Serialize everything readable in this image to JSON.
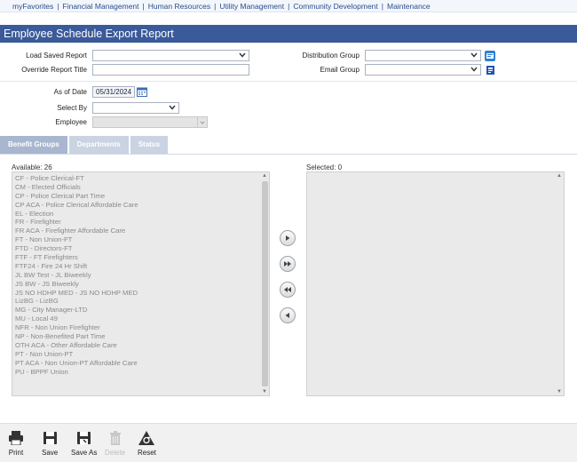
{
  "topnav": {
    "items": [
      "myFavorites",
      "Financial Management",
      "Human Resources",
      "Utility Management",
      "Community Development",
      "Maintenance"
    ],
    "separator": "|"
  },
  "title": "Employee Schedule Export Report",
  "form": {
    "load_saved_report": {
      "label": "Load Saved Report",
      "value": ""
    },
    "override_report_title": {
      "label": "Override Report Title",
      "value": ""
    },
    "distribution_group": {
      "label": "Distribution Group",
      "value": ""
    },
    "email_group": {
      "label": "Email Group",
      "value": ""
    },
    "as_of_date": {
      "label": "As of Date",
      "value": "05/31/2024"
    },
    "select_by": {
      "label": "Select By",
      "value": ""
    },
    "employee": {
      "label": "Employee",
      "value": ""
    }
  },
  "tabs": [
    {
      "label": "Benefit Groups",
      "active": true
    },
    {
      "label": "Departments",
      "active": false
    },
    {
      "label": "Status",
      "active": false
    }
  ],
  "available": {
    "label": "Available: 26",
    "items": [
      "CF - Police Clerical-FT",
      "CM - Elected Officials",
      "CP - Police Clerical Part Time",
      "CP ACA - Police Clerical Affordable Care",
      "EL - Election",
      "FR - Firefighter",
      "FR ACA - Firefighter Affordable Care",
      "FT - Non Union-FT",
      "FTD - Directors-FT",
      "FTF - FT Firefighters",
      "FTF24 - Fire 24 Hr Shift",
      "JL BW Test - JL Biweekly",
      "JS BW - JS Biweekly",
      "JS NO HDHP MED - JS NO HDHP MED",
      "LizBG - LizBG",
      "MG - City Manager-LTD",
      "MU - Local 49",
      "NFR - Non Union Firefighter",
      "NP - Non-Benefited Part Time",
      "OTH ACA - Other Affordable Care",
      "PT - Non Union-PT",
      "PT ACA - Non Union-PT Affordable Care",
      "PU - BPPF Union"
    ]
  },
  "selected": {
    "label": "Selected: 0",
    "items": []
  },
  "move_buttons": [
    "move-right",
    "move-all-right",
    "move-all-left",
    "move-left"
  ],
  "toolbar": {
    "print": "Print",
    "save": "Save",
    "save_as": "Save As",
    "delete": "Delete",
    "reset": "Reset"
  },
  "colors": {
    "header": "#3b5a9a",
    "link": "#2a4d8f",
    "tab_active": "#a8b6cf",
    "tab_inactive": "#c9d3e2"
  }
}
